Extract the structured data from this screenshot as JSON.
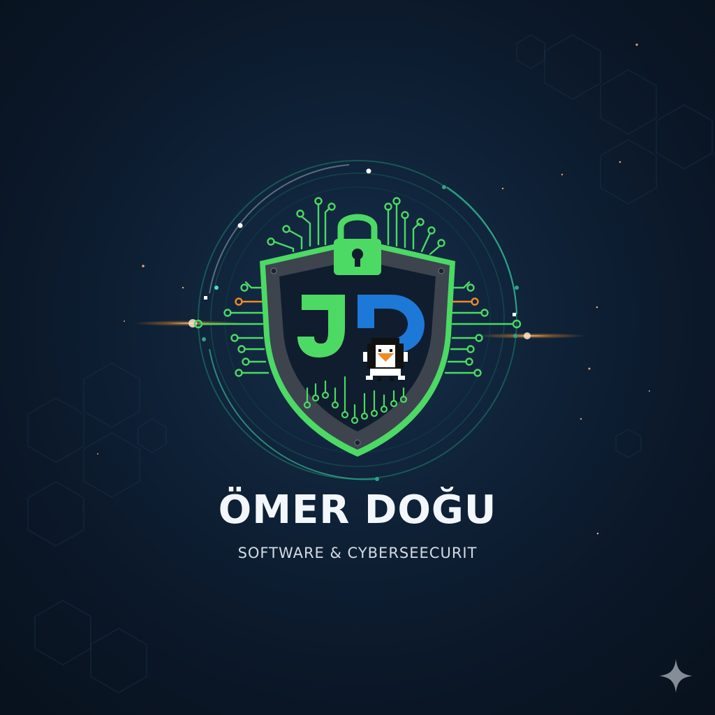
{
  "logo": {
    "monogram": "JD",
    "lock_icon": "padlock-icon",
    "mascot_icon": "penguin-icon",
    "theme": "shield-circuit-board"
  },
  "brand": {
    "name": "ÖMER DOĞU",
    "tagline": "SOFTWARE & CYBERSEECURIT"
  },
  "colors": {
    "background": "#0f2238",
    "accent_green": "#4cd964",
    "accent_blue": "#1d78d8",
    "accent_orange": "#f08a24",
    "shield_gray": "#3d444e",
    "text_white": "#f3f6fa"
  },
  "corner_icon": "sparkle-icon"
}
